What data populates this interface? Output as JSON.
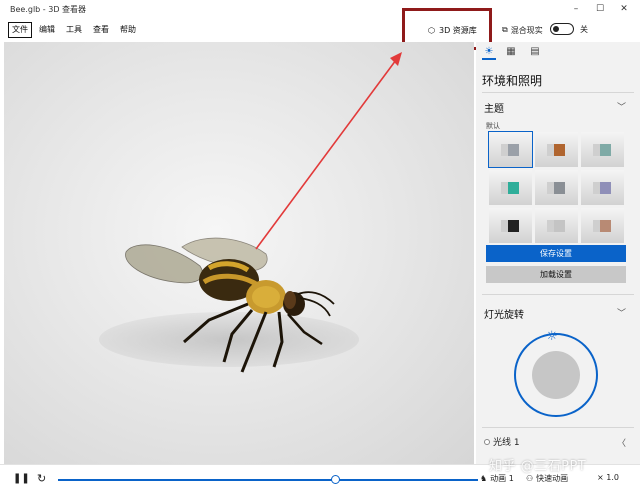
{
  "window": {
    "title": "Bee.glb - 3D 查看器",
    "minimize": "–",
    "maximize": "☐",
    "close": "✕"
  },
  "menu": [
    "文件",
    "编辑",
    "工具",
    "查看",
    "帮助"
  ],
  "toolbar": {
    "library_label": "3D 资源库",
    "mixed_reality_label": "混合现实",
    "toggle_state_label": "关",
    "highlight_color": "#8f1a1a",
    "arrow_color": "#e23a3a"
  },
  "panel": {
    "tabs": [
      "☀",
      "▦",
      "▤"
    ],
    "title": "环境和照明",
    "theme_section": "主题",
    "default_label": "默认",
    "theme_colors": [
      "#9aa0a8",
      "#b0652f",
      "#7faaa6",
      "#2fae9a",
      "#8a8f95",
      "#8f8fb8",
      "#222222",
      "#c4c4c4",
      "#b88a74"
    ],
    "save_button": "保存设置",
    "load_button": "加载设置",
    "light_section": "灯光旋转",
    "ray_label": "光线 1",
    "accent": "#0a63c9"
  },
  "bottom": {
    "pause_icon": "❚❚",
    "loop_icon": "↻",
    "progress": 0.66,
    "animation_label": "动画 1",
    "speed_label": "快速动画",
    "speed_value": "× 1.0"
  },
  "watermark": "知乎 @三石PPT"
}
